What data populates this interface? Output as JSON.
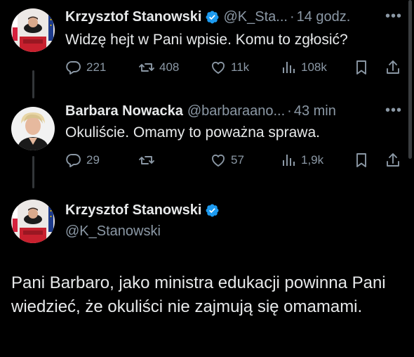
{
  "tweet1": {
    "name": "Krzysztof Stanowski",
    "handle": "@K_Sta...",
    "time": "14 godz.",
    "text": "Widzę hejt w Pani wpisie. Komu to zgłosić?",
    "replies": "221",
    "retweets": "408",
    "likes": "11k",
    "views": "108k"
  },
  "tweet2": {
    "name": "Barbara Nowacka",
    "handle": "@barbaraano...",
    "time": "43 min",
    "text": "Okuliście. Omamy to poważna sprawa.",
    "replies": "29",
    "retweets": "",
    "likes": "57",
    "views": "1,9k"
  },
  "tweet3": {
    "name": "Krzysztof Stanowski",
    "handle": "@K_Stanowski",
    "text": "Pani Barbaro, jako ministra edukacji powinna Pani wiedzieć, że okuliści nie zajmują się omamami."
  },
  "more_label": "•••",
  "colors": {
    "background": "#000000",
    "text": "#e7e9ea",
    "muted": "#8b98a5",
    "verified": "#1d9bf0"
  }
}
